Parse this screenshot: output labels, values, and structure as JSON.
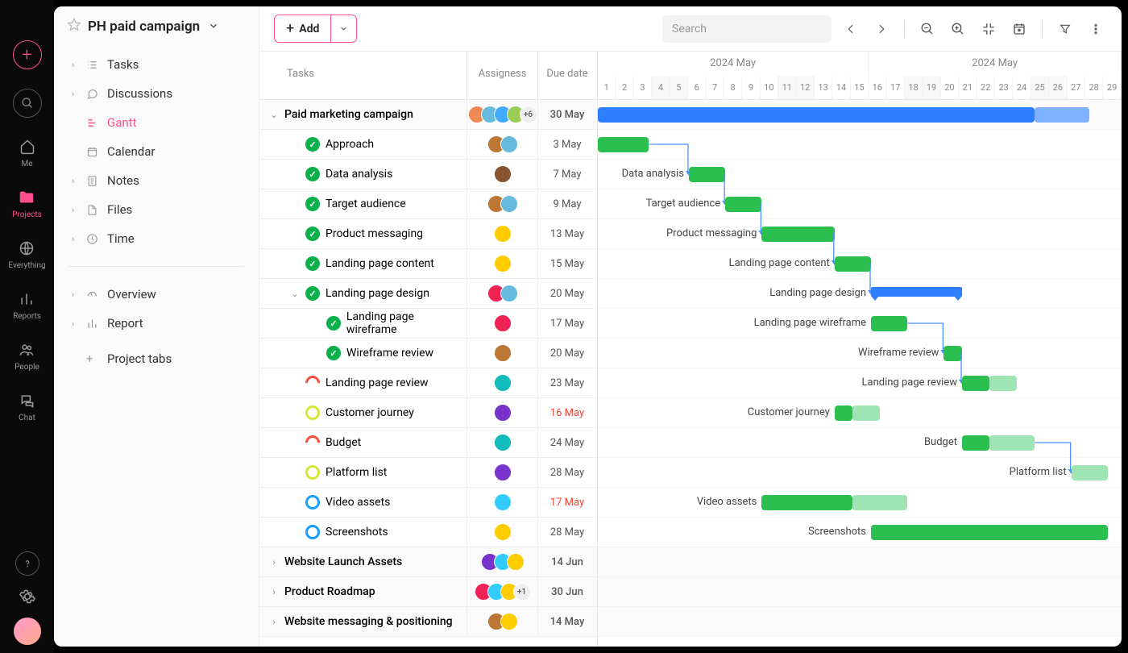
{
  "rail": {
    "items": [
      {
        "label": "Me"
      },
      {
        "label": "Projects"
      },
      {
        "label": "Everything"
      },
      {
        "label": "Reports"
      },
      {
        "label": "People"
      },
      {
        "label": "Chat"
      }
    ]
  },
  "project": {
    "title": "PH paid campaign",
    "tabs": [
      {
        "label": "Tasks",
        "icon": "list"
      },
      {
        "label": "Discussions",
        "icon": "chat"
      },
      {
        "label": "Gantt",
        "icon": "gantt",
        "active": true,
        "noCaret": true
      },
      {
        "label": "Calendar",
        "icon": "calendar",
        "noCaret": true
      },
      {
        "label": "Notes",
        "icon": "note"
      },
      {
        "label": "Files",
        "icon": "file"
      },
      {
        "label": "Time",
        "icon": "clock"
      }
    ],
    "extra": [
      {
        "label": "Overview",
        "icon": "gauge"
      },
      {
        "label": "Report",
        "icon": "bars"
      }
    ],
    "addTab": "Project tabs"
  },
  "toolbar": {
    "add": "Add",
    "searchPlaceholder": "Search"
  },
  "table": {
    "headers": {
      "tasks": "Tasks",
      "assignees": "Assigness",
      "due": "Due date"
    }
  },
  "timeline": {
    "month1": "2024 May",
    "month2": "2024 May",
    "days": [
      1,
      2,
      3,
      4,
      5,
      6,
      7,
      8,
      9,
      10,
      11,
      12,
      13,
      14,
      15,
      16,
      17,
      18,
      19,
      20,
      21,
      22,
      23,
      24,
      25,
      26,
      27,
      28,
      29
    ],
    "weekendIdx": [
      3,
      4,
      10,
      11,
      17,
      18,
      24,
      25
    ]
  },
  "tasks": [
    {
      "name": "Paid marketing campaign",
      "due": "30 May",
      "group": true,
      "level": 0,
      "avatars": [
        "#e85",
        "#6bd",
        "#4af",
        "#9c5"
      ],
      "extra": "+6",
      "bar": {
        "type": "blue",
        "start": 0,
        "len": 24,
        "light": 3
      }
    },
    {
      "name": "Approach",
      "due": "3 May",
      "status": "done",
      "level": 1,
      "avatars": [
        "#b73",
        "#6bd"
      ],
      "bar": {
        "type": "green",
        "start": 0,
        "len": 2.8
      },
      "dep": true
    },
    {
      "name": "Data analysis",
      "due": "7 May",
      "status": "done",
      "level": 1,
      "avatars": [
        "#853"
      ],
      "bar": {
        "type": "green",
        "start": 5,
        "len": 2,
        "label": "Data analysis"
      },
      "dep": true
    },
    {
      "name": "Target audience",
      "due": "9 May",
      "status": "done",
      "level": 1,
      "avatars": [
        "#b73",
        "#6bd"
      ],
      "bar": {
        "type": "green",
        "start": 7,
        "len": 2,
        "label": "Target audience"
      },
      "dep": true
    },
    {
      "name": "Product messaging",
      "due": "13 May",
      "status": "done",
      "level": 1,
      "avatars": [
        "#fc0"
      ],
      "bar": {
        "type": "green",
        "start": 9,
        "len": 4,
        "label": "Product messaging"
      },
      "dep": true
    },
    {
      "name": "Landing page content",
      "due": "15 May",
      "status": "done",
      "level": 1,
      "avatars": [
        "#fc0"
      ],
      "bar": {
        "type": "green",
        "start": 13,
        "len": 2,
        "label": "Landing page content"
      },
      "dep": true
    },
    {
      "name": "Landing page design",
      "due": "20 May",
      "status": "done",
      "level": 1,
      "expandable": true,
      "avatars": [
        "#e25",
        "#6bd"
      ],
      "bar": {
        "type": "bracket",
        "start": 15,
        "len": 5,
        "label": "Landing page design"
      }
    },
    {
      "name": "Landing page wireframe",
      "due": "17 May",
      "status": "done",
      "level": 2,
      "avatars": [
        "#e25"
      ],
      "bar": {
        "type": "green",
        "start": 15,
        "len": 2,
        "label": "Landing page wireframe"
      },
      "dep": true
    },
    {
      "name": "Wireframe review",
      "due": "20 May",
      "status": "done",
      "level": 2,
      "avatars": [
        "#b73"
      ],
      "bar": {
        "type": "green",
        "start": 19,
        "len": 1,
        "label": "Wireframe review"
      },
      "dep": true
    },
    {
      "name": "Landing page review",
      "due": "23 May",
      "status": "half-red",
      "level": 1,
      "avatars": [
        "#1bb"
      ],
      "bar": {
        "type": "green",
        "start": 20,
        "len": 1.5,
        "light": 1.5,
        "label": "Landing page review"
      }
    },
    {
      "name": "Customer journey",
      "due": "16 May",
      "overdue": true,
      "status": "ring-yellow",
      "level": 1,
      "avatars": [
        "#73c"
      ],
      "bar": {
        "type": "green",
        "start": 13,
        "len": 1,
        "light": 1.5,
        "label": "Customer journey"
      }
    },
    {
      "name": "Budget",
      "due": "24 May",
      "status": "half-red",
      "level": 1,
      "avatars": [
        "#1bb"
      ],
      "bar": {
        "type": "green",
        "start": 20,
        "len": 1.5,
        "light": 2.5,
        "label": "Budget"
      },
      "dep": true
    },
    {
      "name": "Platform list",
      "due": "28 May",
      "status": "ring-yellow",
      "level": 1,
      "avatars": [
        "#73c"
      ],
      "bar": {
        "type": "green",
        "start": 26,
        "len": 0,
        "light": 2,
        "label": "Platform list"
      }
    },
    {
      "name": "Video assets",
      "due": "17 May",
      "overdue": true,
      "status": "ring-blue",
      "level": 1,
      "avatars": [
        "#3cf"
      ],
      "bar": {
        "type": "green",
        "start": 9,
        "len": 5,
        "light": 3,
        "label": "Video assets"
      }
    },
    {
      "name": "Screenshots",
      "due": "28 May",
      "status": "ring-blue",
      "level": 1,
      "avatars": [
        "#fc0"
      ],
      "bar": {
        "type": "green",
        "start": 15,
        "len": 13,
        "label": "Screenshots"
      }
    },
    {
      "name": "Website Launch Assets",
      "due": "14 Jun",
      "group": true,
      "collapsed": true,
      "level": 0,
      "avatars": [
        "#73c",
        "#3cf",
        "#fc0"
      ]
    },
    {
      "name": "Product Roadmap",
      "due": "30 Jun",
      "group": true,
      "collapsed": true,
      "level": 0,
      "avatars": [
        "#e25",
        "#3cf",
        "#fc0"
      ],
      "extra": "+1"
    },
    {
      "name": "Website messaging & positioning",
      "due": "14 May",
      "group": true,
      "collapsed": true,
      "level": 0,
      "avatars": [
        "#b73",
        "#fc0"
      ]
    }
  ],
  "avatar_colors": [
    "#e85",
    "#6bd",
    "#4af",
    "#9c5",
    "#b73",
    "#853",
    "#fc0",
    "#e25",
    "#1bb",
    "#73c",
    "#3cf"
  ]
}
